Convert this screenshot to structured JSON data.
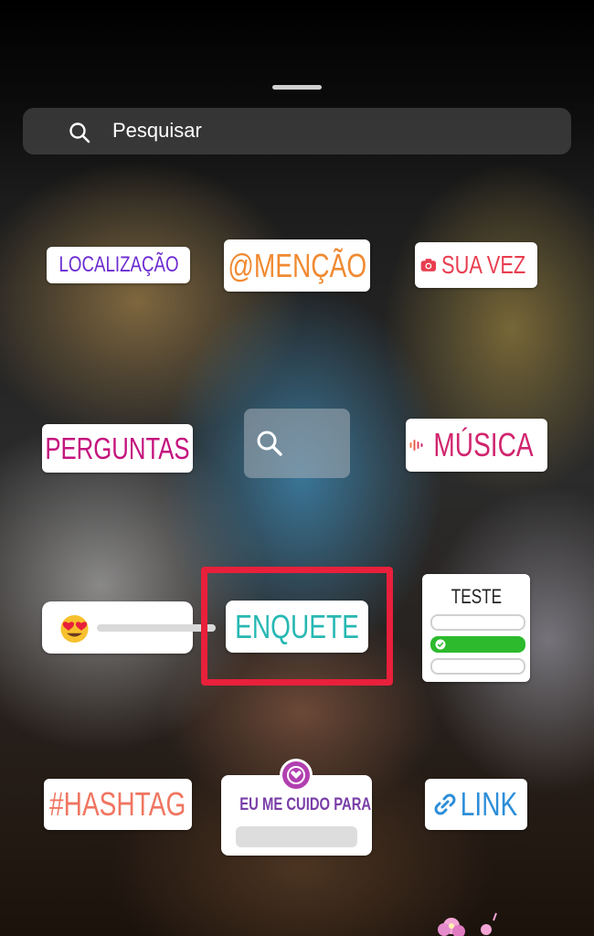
{
  "search": {
    "placeholder": "Pesquisar",
    "icon": "search-icon"
  },
  "stickers": {
    "location": {
      "label": "LOCALIZAÇÃO",
      "icon": "location-pin-icon",
      "color": "#6b2bd0"
    },
    "mention": {
      "label": "@MENÇÃO",
      "color": "#f08a32"
    },
    "your_turn": {
      "label": "SUA VEZ",
      "icon": "camera-icon",
      "color": "#e83e50"
    },
    "questions": {
      "label": "PERGUNTAS",
      "color": "#c4147e"
    },
    "gif_search": {
      "icon": "search-icon"
    },
    "music": {
      "label": "MÚSICA",
      "icon": "audio-bars-icon",
      "color": "#d1256e"
    },
    "emoji_slider": {
      "icon": "heart-eyes-emoji-icon"
    },
    "poll": {
      "label": "ENQUETE",
      "icon": "poll-lines-icon",
      "color": "#27b8b3"
    },
    "quiz": {
      "label": "TESTE",
      "icon": "check-icon",
      "correct_color": "#2dba2d"
    },
    "hashtag": {
      "label": "#HASHTAG",
      "color": "#f07560"
    },
    "self_care": {
      "label": "EU ME CUIDO PARA",
      "icon": "heart-hands-icon",
      "color": "#7a3ea8"
    },
    "link": {
      "label": "LINK",
      "icon": "link-icon",
      "color": "#2d8ed8"
    }
  },
  "highlight_color": "#e8203b"
}
